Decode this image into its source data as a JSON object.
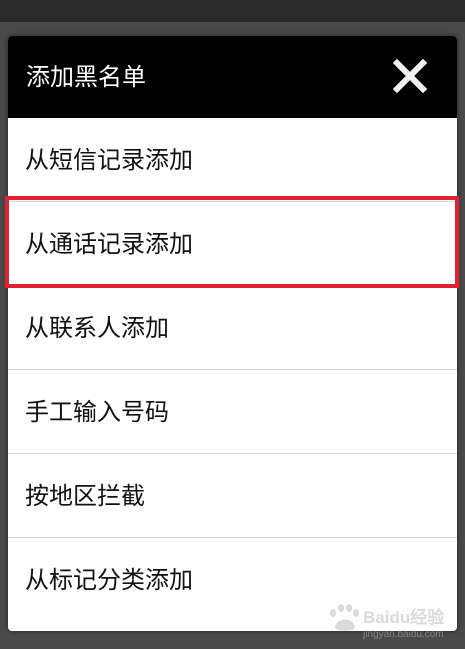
{
  "dialog": {
    "title": "添加黑名单",
    "close_icon": "close-icon",
    "items": [
      {
        "label": "从短信记录添加"
      },
      {
        "label": "从通话记录添加"
      },
      {
        "label": "从联系人添加"
      },
      {
        "label": "手工输入号码"
      },
      {
        "label": "按地区拦截"
      },
      {
        "label": "从标记分类添加"
      }
    ]
  },
  "highlight": {
    "color": "#e0222e",
    "item_index": 1
  },
  "watermark": {
    "text": "Baidu经验",
    "url_text": "jingyan.baidu.com"
  }
}
